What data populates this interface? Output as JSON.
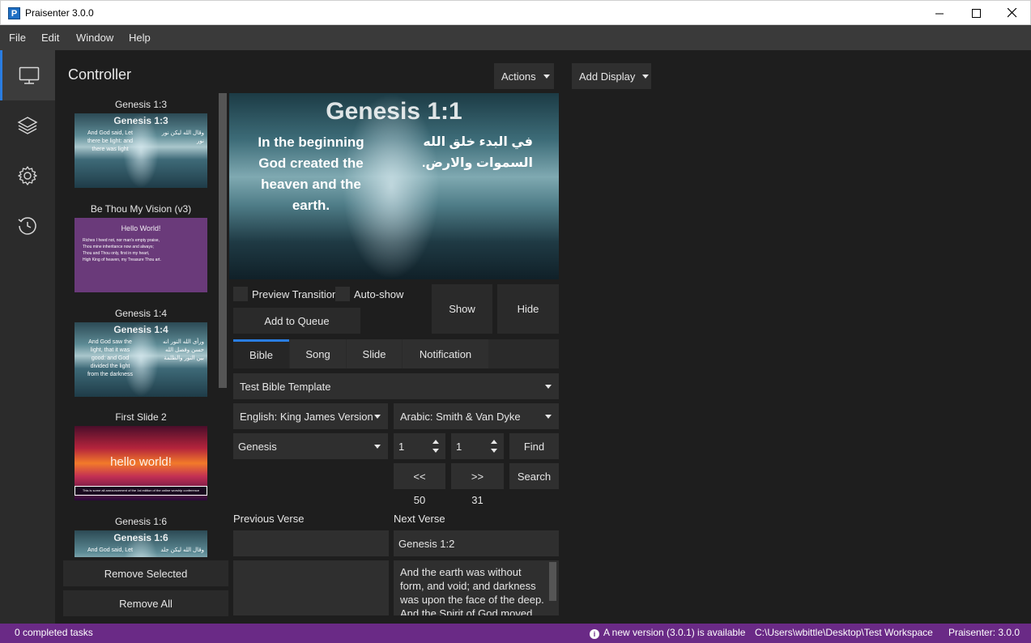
{
  "window": {
    "title": "Praisenter 3.0.0",
    "app_icon_letter": "P"
  },
  "menu": [
    "File",
    "Edit",
    "Window",
    "Help"
  ],
  "nav": [
    {
      "name": "monitor-icon",
      "active": true
    },
    {
      "name": "layers-icon",
      "active": false
    },
    {
      "name": "gear-icon",
      "active": false
    },
    {
      "name": "history-icon",
      "active": false
    }
  ],
  "controller": {
    "title": "Controller",
    "actions_label": "Actions",
    "add_display_label": "Add Display"
  },
  "queue": {
    "items": [
      {
        "title": "Genesis 1:3",
        "big": "Genesis 1:3",
        "lines_left": "And God said, Let\nthere be light: and\nthere was light",
        "lines_right": "وقال الله ليكن نور\nنور"
      },
      {
        "title": "Be Thou My Vision (v3)",
        "big": "Hello World!",
        "lines_left": "Riches I heed not, nor man's empty praise,\nThou mine inheritance now and always;\nThou and Thou only, first in my heart,\nHigh King of heaven, my Treasure Thou art."
      },
      {
        "title": "Genesis 1:4",
        "big": "Genesis 1:4",
        "lines_left": "And God saw the\nlight, that it was\ngood: and God\ndivided the light\nfrom the darkness",
        "lines_right": "ورأى الله النور انه\nحسن وفصل الله\nبين النور والظلمة"
      },
      {
        "title": "First Slide 2",
        "big": "hello world!",
        "lines_left": "This is some all announcement of the 1st edition of the online worship conference"
      },
      {
        "title": "Genesis 1:6",
        "big": "Genesis 1:6",
        "lines_left": "And God said, Let",
        "lines_right": "وقال الله ليكن جلد"
      }
    ],
    "remove_selected_label": "Remove Selected",
    "remove_all_label": "Remove All"
  },
  "preview": {
    "title": "Genesis 1:1",
    "text_en": "In the beginning God created the heaven and the earth.",
    "text_ar": "في البدء خلق الله السموات والارض."
  },
  "controls": {
    "preview_transition_label": "Preview Transition",
    "auto_show_label": "Auto-show",
    "add_to_queue_label": "Add to Queue",
    "show_label": "Show",
    "hide_label": "Hide"
  },
  "tabs": [
    {
      "label": "Bible",
      "active": true
    },
    {
      "label": "Song",
      "active": false
    },
    {
      "label": "Slide",
      "active": false
    },
    {
      "label": "Notification",
      "active": false
    }
  ],
  "bible": {
    "template": "Test Bible Template",
    "primary_translation": "English: King James Version",
    "secondary_translation": "Arabic: Smith & Van Dyke",
    "book": "Genesis",
    "chapter": "1",
    "verse": "1",
    "find_label": "Find",
    "prev_label": "<<",
    "next_label": ">>",
    "search_label": "Search",
    "chapter_count": "50",
    "verse_count": "31",
    "previous_verse_label": "Previous Verse",
    "next_verse_label": "Next Verse",
    "previous_verse_ref": "",
    "next_verse_ref": "Genesis 1:2",
    "previous_verse_text": "",
    "next_verse_text": "And the earth was without form, and void; and darkness was upon the face of the deep. And the Spirit of God moved upon the face of the waters."
  },
  "status": {
    "tasks": "0 completed tasks",
    "update": "A new version (3.0.1) is available",
    "workspace": "C:\\Users\\wbittle\\Desktop\\Test Workspace",
    "version": "Praisenter: 3.0.0"
  },
  "colors": {
    "accent": "#2a7de1",
    "status_bar": "#6a2a86",
    "background": "#1e1e1e"
  }
}
